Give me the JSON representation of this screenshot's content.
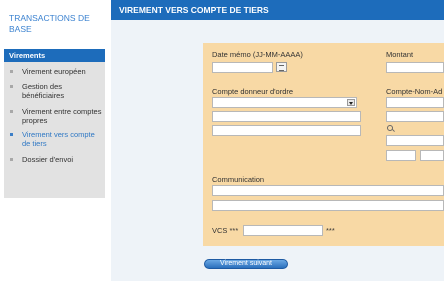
{
  "sidebar": {
    "title": "TRANSACTIONS DE BASE",
    "section": "Virements",
    "items": [
      {
        "label": "Virement européen"
      },
      {
        "label": "Gestion des bénéficiaires"
      },
      {
        "label": "Virement entre comptes propres"
      },
      {
        "label": "Virement vers compte de tiers",
        "active": true
      },
      {
        "label": "Dossier d'envoi"
      }
    ]
  },
  "header": {
    "title": "VIREMENT VERS COMPTE DE TIERS"
  },
  "form": {
    "date_label": "Date mémo (JJ-MM-AAAA)",
    "amount_label": "Montant",
    "account_label": "Compte donneur d'ordre",
    "counterparty_label": "Compte-Nom-Ad",
    "communication_label": "Communication",
    "vcs_label": "VCS ***",
    "vcs_suffix": "***",
    "date_value": "",
    "amount_value": "",
    "vcs_value": ""
  },
  "actions": {
    "next_label": "Virement suivant"
  },
  "colors": {
    "brand_blue": "#1d6cbb",
    "form_bg": "#f8d9a5",
    "sidebar_panel": "#e2e2e2"
  }
}
